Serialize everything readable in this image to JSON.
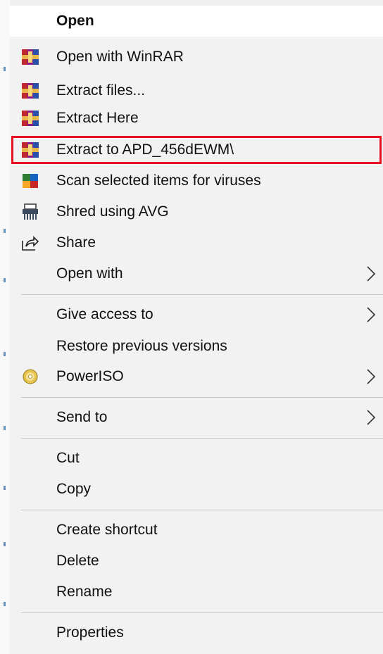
{
  "menu": {
    "items": [
      {
        "label": "Open"
      },
      {
        "label": "Open with WinRAR"
      },
      {
        "label": "Extract files..."
      },
      {
        "label": "Extract Here"
      },
      {
        "label": "Extract to APD_456dEWM\\"
      },
      {
        "label": "Scan selected items for viruses"
      },
      {
        "label": "Shred using AVG"
      },
      {
        "label": "Share"
      },
      {
        "label": "Open with"
      },
      {
        "label": "Give access to"
      },
      {
        "label": "Restore previous versions"
      },
      {
        "label": "PowerISO"
      },
      {
        "label": "Send to"
      },
      {
        "label": "Cut"
      },
      {
        "label": "Copy"
      },
      {
        "label": "Create shortcut"
      },
      {
        "label": "Delete"
      },
      {
        "label": "Rename"
      },
      {
        "label": "Properties"
      }
    ]
  },
  "icons": {
    "winrar": "winrar-icon",
    "avg_scan": "avg-scan-icon",
    "shredder": "shredder-icon",
    "share": "share-icon",
    "poweriso": "poweriso-icon",
    "submenu": "chevron-right-icon"
  },
  "colors": {
    "highlight_border": "#e81123",
    "menu_background": "#f2f2f2",
    "hover_background": "#ffffff"
  }
}
